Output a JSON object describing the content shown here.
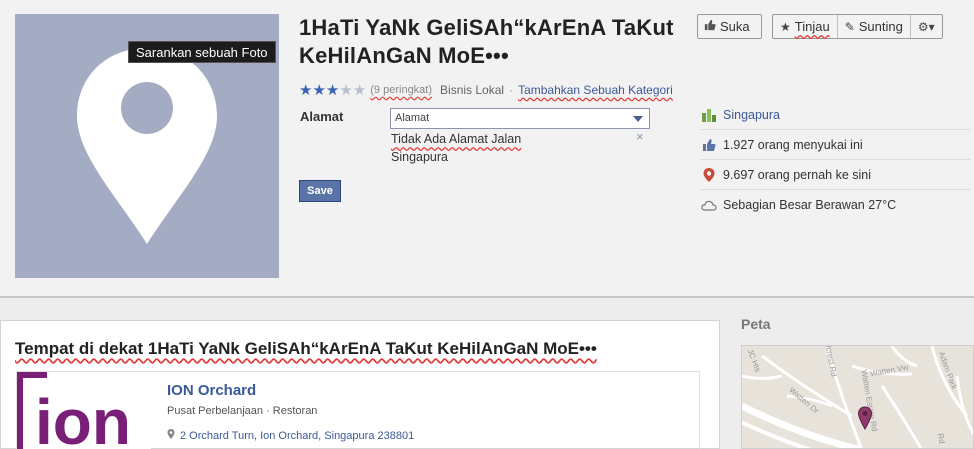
{
  "header": {
    "photo_suggest_label": "Sarankan sebuah Foto",
    "title": "1HaTi YaNk GeliSAh“kArEnA TaKut KeHilAnGaN MoE•••",
    "rating": {
      "stars_filled": 3,
      "stars_total": 5,
      "count_label": "(9 peringkat)"
    },
    "category": "Bisnis Lokal",
    "separator": "·",
    "add_category_label": "Tambahkan Sebuah Kategori"
  },
  "address_form": {
    "label": "Alamat",
    "select_value": "Alamat",
    "street_value": "Tidak Ada Alamat Jalan",
    "remove_glyph": "×",
    "city_value": "Singapura",
    "save_label": "Save"
  },
  "actions": {
    "like_label": "Suka",
    "review_label": "Tinjau",
    "edit_label": "Sunting",
    "settings_glyph": "⚙▾"
  },
  "info": {
    "location": "Singapura",
    "likes": "1.927 orang menyukai ini",
    "checkins": "9.697 orang pernah ke sini",
    "weather": "Sebagian Besar Berawan 27°C"
  },
  "nearby": {
    "title": "Tempat di dekat 1HaTi YaNk GeliSAh“kArEnA TaKut KeHilAnGaN MoE•••",
    "places": [
      {
        "logo_text": "ion",
        "name": "ION Orchard",
        "type": "Pusat Perbelanjaan · Restoran",
        "address": "2 Orchard Turn, Ion Orchard, Singapura 238801"
      }
    ]
  },
  "map": {
    "label": "Peta",
    "streets": [
      "Watten Dr",
      "Watten Vw",
      "Adam Park",
      "Hillcrest Rd",
      "Watten Estate Rd",
      "Rd",
      "JC Hts"
    ]
  },
  "colors": {
    "brand_blue": "#3b5998",
    "photo_placeholder": "#a4acc4",
    "spellcheck_red": "#e23a3a",
    "ion_purple": "#7a1f78"
  }
}
